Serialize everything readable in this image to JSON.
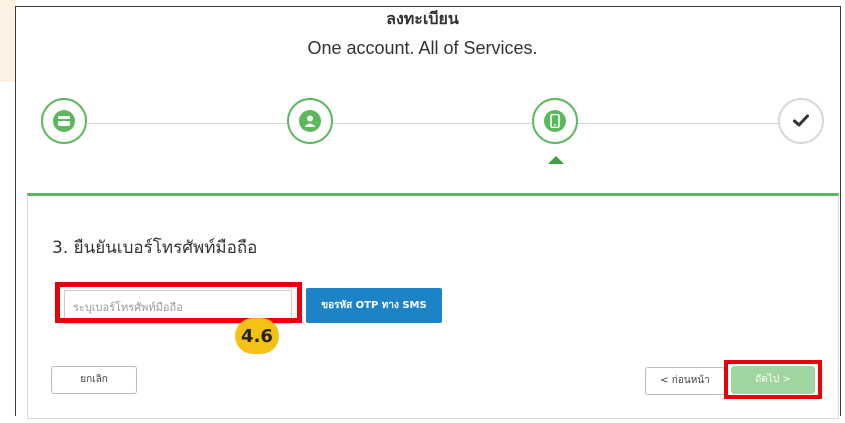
{
  "header": {
    "title": "ลงทะเบียน",
    "subtitle": "One account. All of Services."
  },
  "steps": [
    {
      "icon": "id-card-icon",
      "state": "complete"
    },
    {
      "icon": "user-icon",
      "state": "complete"
    },
    {
      "icon": "mobile-phone-icon",
      "state": "current"
    },
    {
      "icon": "check-icon",
      "state": "pending"
    }
  ],
  "form": {
    "heading": "3. ยืนยันเบอร์โทรศัพท์มือถือ",
    "phone_placeholder": "ระบุเบอร์โทรศัพท์มือถือ",
    "phone_value": "",
    "otp_button_label": "ขอรหัส OTP ทาง SMS"
  },
  "annotation": {
    "step_badge": "4.6"
  },
  "actions": {
    "cancel_label": "ยกเลิก",
    "back_label": "< ก่อนหน้า",
    "next_label": "ถัดไป >"
  },
  "colors": {
    "accent_green": "#5cb85c",
    "button_blue": "#1d83c7",
    "highlight_red": "#e8000b",
    "badge_yellow": "#f5c214"
  }
}
